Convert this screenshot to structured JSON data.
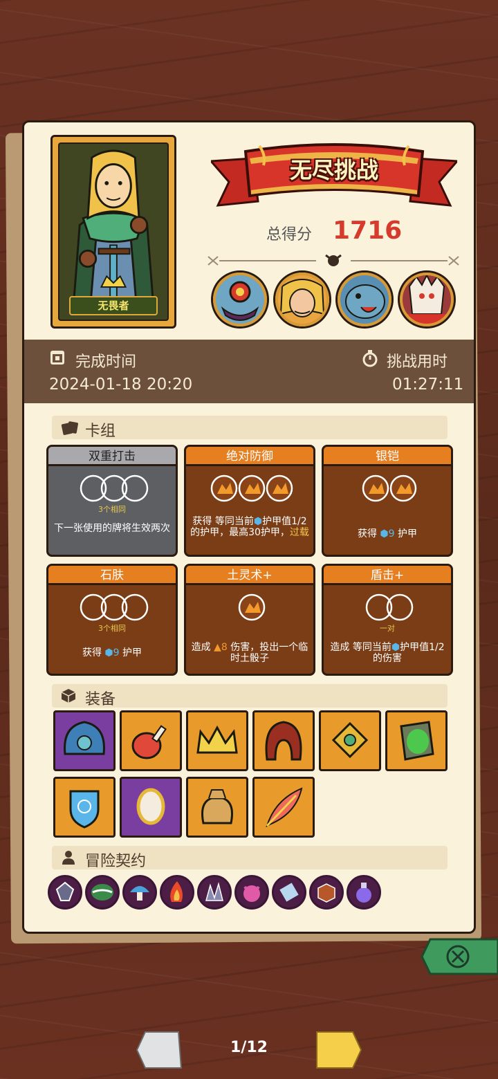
{
  "hero": {
    "name": "无畏者"
  },
  "banner": {
    "title": "无尽挑战"
  },
  "score": {
    "label": "总得分",
    "value": "1716"
  },
  "bosses": [
    "eye-monster-icon",
    "lion-warrior-icon",
    "blue-beast-icon",
    "bone-demon-icon"
  ],
  "time": {
    "complete_label": "完成时间",
    "complete_value": "2024-01-18 20:20",
    "duration_label": "挑战用时",
    "duration_value": "01:27:11"
  },
  "deck": {
    "title": "卡组",
    "cards": [
      {
        "name": "双重打击",
        "sub": "3个相同",
        "desc": "下一张使用的牌将生效两次",
        "style": "gray",
        "orbs": 3
      },
      {
        "name": "绝对防御",
        "sub": "",
        "desc_parts": [
          "获得 等同当前",
          "护甲值1/2的护甲，最高30护甲，",
          "过载"
        ],
        "style": "orange",
        "orbs": 3
      },
      {
        "name": "银铠",
        "sub": "",
        "desc_parts": [
          "获得 ",
          "9",
          " 护甲"
        ],
        "style": "orange",
        "orbs": 2
      },
      {
        "name": "石肤",
        "sub": "3个相同",
        "desc_parts": [
          "获得 ",
          "9",
          " 护甲"
        ],
        "style": "orange",
        "orbs": 3
      },
      {
        "name": "土灵术+",
        "sub": "",
        "desc_parts": [
          "造成 ",
          "8",
          " 伤害，投出一个临时土骰子"
        ],
        "style": "orange",
        "orbs": 1
      },
      {
        "name": "盾击+",
        "sub": "一对",
        "desc_parts": [
          "造成 等同当前",
          "护甲值1/2的伤害"
        ],
        "style": "orange",
        "orbs": 2
      }
    ]
  },
  "equipment": {
    "title": "装备",
    "items": [
      "blue-helm-icon",
      "meat-leg-icon",
      "crown-icon",
      "red-hood-icon",
      "gold-charm-icon",
      "moss-stone-icon",
      "blue-shield-icon",
      "mirror-icon",
      "coin-bag-icon",
      "feather-icon"
    ]
  },
  "contracts": {
    "title": "冒险契约",
    "items": [
      "gem-icon",
      "serpent-icon",
      "mushroom-icon",
      "fire-icon",
      "beast-claw-icon",
      "pink-demon-icon",
      "scroll-icon",
      "box-icon",
      "potion-icon"
    ]
  },
  "pager": {
    "text": "1/12"
  },
  "colors": {
    "accent": "#e57f20",
    "score": "#d63a2c",
    "panel": "#fbf2dc",
    "bar": "#6d503c",
    "purple": "#7a3ea0"
  }
}
